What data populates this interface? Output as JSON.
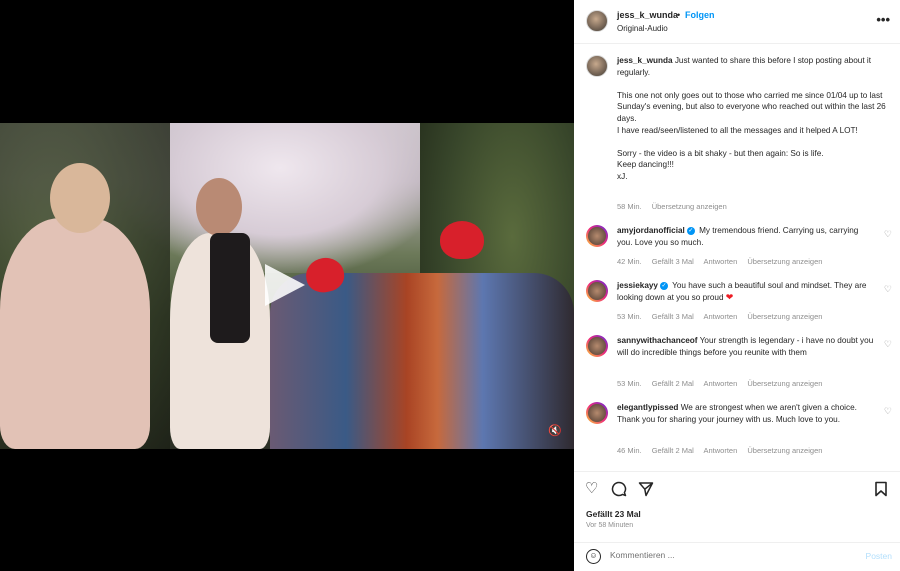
{
  "header": {
    "username": "jess_k_wunda",
    "separator": "•",
    "follow_label": "Folgen",
    "audio_label": "Original-Audio",
    "more_icon": "more-horizontal-icon"
  },
  "caption": {
    "username": "jess_k_wunda",
    "text": "Just wanted to share this before I stop posting about it regularly.\n\nThis one not only goes out to those who carried me since 01/04 up to last Sunday's evening, but also to everyone who reached out within the last 26 days.\nI have read/seen/listened to all the messages and it helped A LOT!\n\nSorry - the video is a bit shaky - but then again: So is life.\nKeep dancing!!!\nxJ.",
    "time": "58 Min.",
    "translate_label": "Übersetzung anzeigen"
  },
  "comments": [
    {
      "username": "amyjordanofficial",
      "verified": true,
      "text": "My tremendous friend. Carrying us, carrying you. Love you so much.",
      "emoji": "",
      "time": "42 Min.",
      "likes": "Gefällt 3 Mal",
      "reply_label": "Antworten",
      "translate_label": "Übersetzung anzeigen"
    },
    {
      "username": "jessiekayy",
      "verified": true,
      "text": "You have such a beautiful soul and mindset. They are looking down at you so proud",
      "emoji": "❤",
      "time": "53 Min.",
      "likes": "Gefällt 3 Mal",
      "reply_label": "Antworten",
      "translate_label": "Übersetzung anzeigen"
    },
    {
      "username": "sannywithachanceof",
      "verified": false,
      "text": "Your strength is legendary - i have no doubt you will do incredible things before you reunite with them",
      "emoji": "",
      "time": "53 Min.",
      "likes": "Gefällt 2 Mal",
      "reply_label": "Antworten",
      "translate_label": "Übersetzung anzeigen"
    },
    {
      "username": "elegantlypissed",
      "verified": false,
      "text": "We are strongest when we aren't given a choice. Thank you for sharing your journey with us. Much love to you.",
      "emoji": "",
      "time": "46 Min.",
      "likes": "Gefällt 2 Mal",
      "reply_label": "Antworten",
      "translate_label": "Übersetzung anzeigen"
    }
  ],
  "actions": {
    "likes_text": "Gefällt 23 Mal",
    "time_ago": "Vor 58 Minuten",
    "comment_placeholder": "Kommentieren ...",
    "post_label": "Posten"
  },
  "colors": {
    "accent": "#0095f6",
    "meta": "#8e8e8e",
    "heart": "#ed1c24"
  }
}
